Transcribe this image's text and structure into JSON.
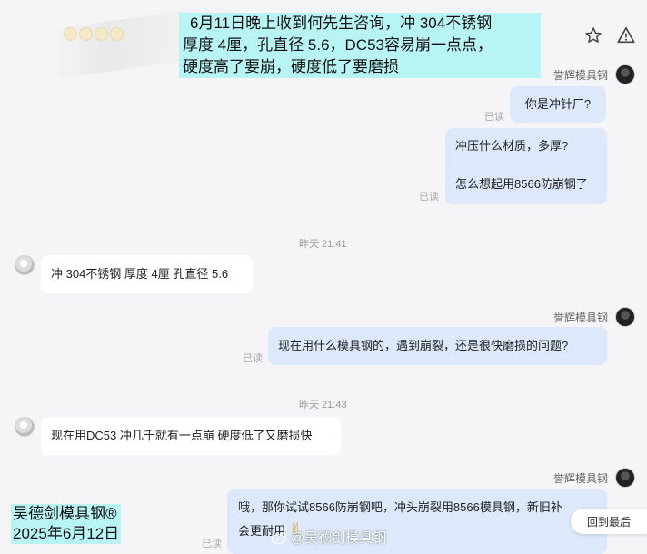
{
  "headline": {
    "line1": "6月11日晚上收到何先生咨询，冲 304不锈钢",
    "line2": "厚度 4厘，孔直径 5.6，DC53容易崩一点点，",
    "line3": "硬度高了要崩，硬度低了要磨损"
  },
  "header_icons": [
    "star-icon",
    "alert-icon"
  ],
  "messages": {
    "m1": {
      "sender": "誉辉模具钢",
      "text": "你是冲针厂?",
      "status": "已读"
    },
    "m2": {
      "line1": "冲压什么材质，多厚?",
      "line2": "怎么想起用8566防崩钢了",
      "status": "已读"
    },
    "t1": "昨天 21:41",
    "m3": {
      "text": "冲 304不锈钢 厚度 4厘  孔直径 5.6"
    },
    "m4": {
      "sender": "誉辉模具钢",
      "text": "现在用什么模具钢的，遇到崩裂，还是很快磨损的问题?",
      "status": "已读"
    },
    "t2": "昨天 21:43",
    "m5": {
      "text": "现在用DC53 冲几千就有一点崩 硬度低了又磨损快"
    },
    "m6": {
      "sender": "誉辉模具钢",
      "line1": "哦，那你试试8566防崩钢吧，冲头崩裂用8566模具钢，新旧补",
      "line2": "会更耐用",
      "emoji": "✌",
      "status": "已读"
    }
  },
  "signature": {
    "line1": "吴德剑模具钢®",
    "line2": "2025年6月12日"
  },
  "scroll_button": "回到最后",
  "watermark": "@吴德剑模具钢"
}
